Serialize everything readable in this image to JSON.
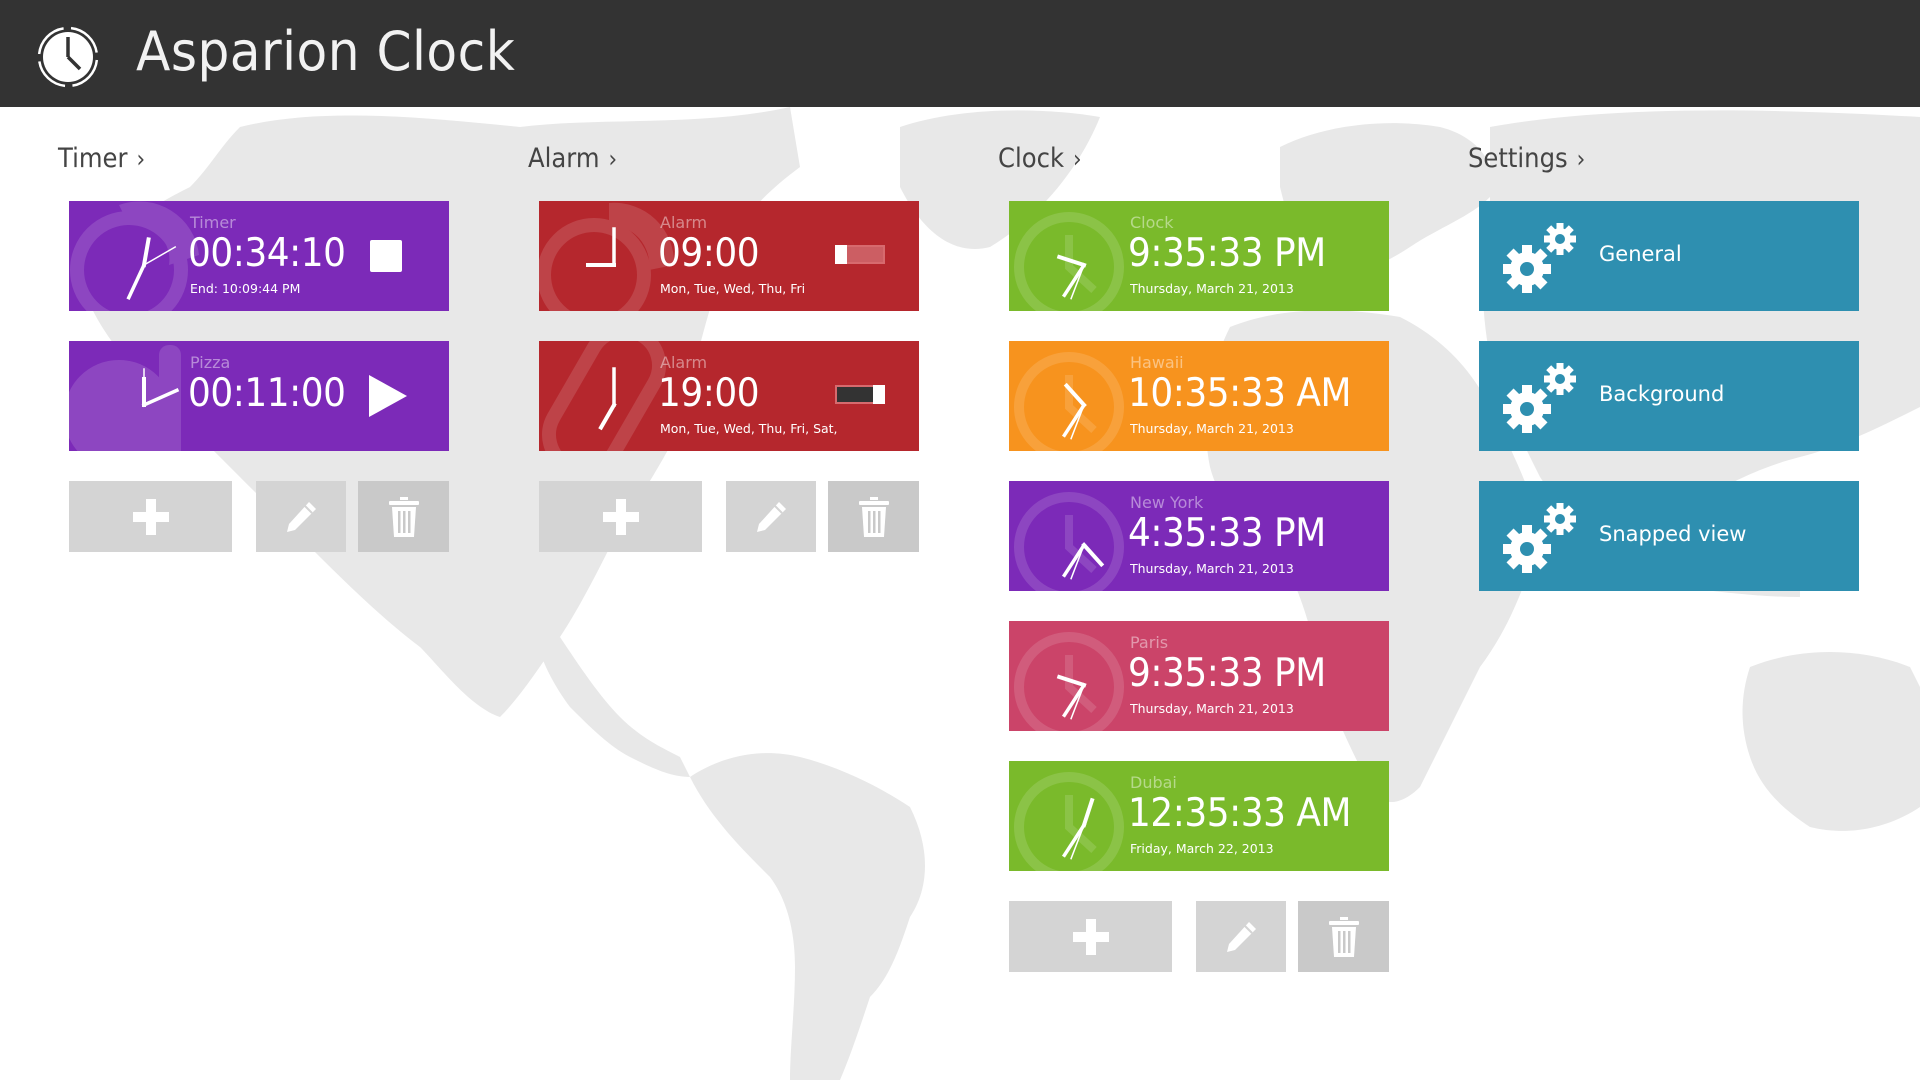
{
  "app": {
    "title": "Asparion Clock",
    "icon": "clock-icon"
  },
  "sections": {
    "timer": {
      "header": "Timer",
      "chevron": "›",
      "items": [
        {
          "label": "Timer",
          "time": "00:34:10",
          "sub": "End: 10:09:44 PM",
          "state": "running",
          "control_icon": "stop-icon",
          "hands": {
            "hour_deg": 10,
            "minute_deg": 205,
            "second_deg": 60
          }
        },
        {
          "label": "Pizza",
          "time": "00:11:00",
          "sub": "",
          "state": "stopped",
          "control_icon": "play-icon",
          "hands": {
            "hour_deg": 0,
            "minute_deg": 66,
            "second_deg": 0
          }
        }
      ],
      "actions": {
        "add_icon": "plus-icon",
        "edit_icon": "pencil-icon",
        "delete_icon": "trash-icon"
      }
    },
    "alarm": {
      "header": "Alarm",
      "chevron": "›",
      "items": [
        {
          "label": "Alarm",
          "time": "09:00",
          "days": "Mon, Tue, Wed, Thu, Fri",
          "enabled": false,
          "hands": {
            "hour_deg": 270,
            "minute_deg": 0
          }
        },
        {
          "label": "Alarm",
          "time": "19:00",
          "days": "Mon, Tue, Wed, Thu, Fri, Sat, Su",
          "enabled": true,
          "hands": {
            "hour_deg": 210,
            "minute_deg": 0
          }
        }
      ],
      "actions": {
        "add_icon": "plus-icon",
        "edit_icon": "pencil-icon",
        "delete_icon": "trash-icon"
      }
    },
    "clock": {
      "header": "Clock",
      "chevron": "›",
      "items": [
        {
          "label": "Clock",
          "time": "9:35:33 PM",
          "date": "Thursday, March 21, 2013",
          "color": "#7aba2b",
          "hands": {
            "hour_deg": 288,
            "minute_deg": 213,
            "second_deg": 201
          }
        },
        {
          "label": "Hawaii",
          "time": "10:35:33 AM",
          "date": "Thursday, March 21, 2013",
          "color": "#f7931e",
          "hands": {
            "hour_deg": 318,
            "minute_deg": 213,
            "second_deg": 201
          }
        },
        {
          "label": "New York",
          "time": "4:35:33 PM",
          "date": "Thursday, March 21, 2013",
          "color": "#7c2ab8",
          "hands": {
            "hour_deg": 138,
            "minute_deg": 213,
            "second_deg": 201
          }
        },
        {
          "label": "Paris",
          "time": "9:35:33 PM",
          "date": "Thursday, March 21, 2013",
          "color": "#cb4469",
          "hands": {
            "hour_deg": 288,
            "minute_deg": 213,
            "second_deg": 201
          }
        },
        {
          "label": "Dubai",
          "time": "12:35:33 AM",
          "date": "Friday, March 22, 2013",
          "color": "#7aba2b",
          "hands": {
            "hour_deg": 18,
            "minute_deg": 213,
            "second_deg": 201
          }
        }
      ],
      "actions": {
        "add_icon": "plus-icon",
        "edit_icon": "pencil-icon",
        "delete_icon": "trash-icon"
      }
    },
    "settings": {
      "header": "Settings",
      "chevron": "›",
      "items": [
        {
          "label": "General",
          "icon": "gears-icon"
        },
        {
          "label": "Background",
          "icon": "gears-icon"
        },
        {
          "label": "Snapped view",
          "icon": "gears-icon"
        }
      ]
    }
  },
  "colors": {
    "topbar": "#333333",
    "timer": "#7c2ab8",
    "alarm": "#b5272d",
    "settings": "#2e8fb0",
    "action_button": "#d4d4d4",
    "map": "#e8e8e8"
  }
}
